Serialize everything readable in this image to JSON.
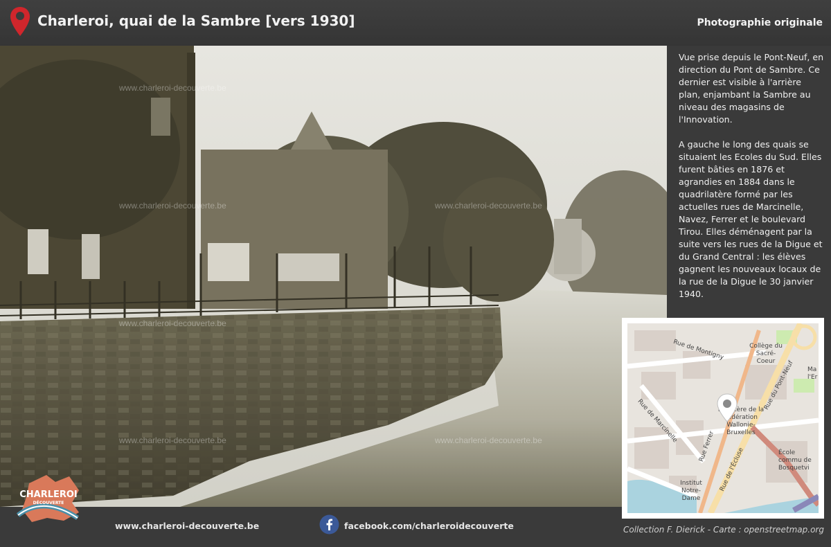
{
  "header": {
    "title": "Charleroi, quai de la Sambre [vers 1930]",
    "subtitle": "Photographie originale",
    "pin_icon": "map-pin-icon",
    "accent_color": "#d0262c"
  },
  "photo": {
    "watermark": "www.charleroi-decouverte.be"
  },
  "description": {
    "paragraph_1": "Vue prise depuis le Pont-Neuf, en direction du Pont de Sambre. Ce dernier est visible à l'arrière plan, enjambant la Sambre au niveau des magasins de l'Innovation.",
    "paragraph_2": "A gauche le long des quais se situaient les Ecoles du Sud. Elles furent bâties en 1876 et agrandies en 1884 dans le quadrilatère formé par les actuelles rues de Marcinelle, Navez, Ferrer et le boulevard Tirou. Elles déménagent par la suite vers les rues de la Digue et du Grand Central : les élèves gagnent les nouveaux locaux de la rue de la Digue le 30 janvier 1940."
  },
  "map": {
    "streets": {
      "montigny": "Rue de Montigny",
      "pont_neuf": "Rue du Pont-Neuf",
      "marcinelle": "Rue de Marcinelle",
      "ferrer": "Rue Ferrer",
      "ecluse": "Rue de l'Écluse"
    },
    "pois": {
      "college": "Collège du Sacré-Coeur",
      "ministere": "Ministère de la Fédération Wallonie-Bruxelles",
      "ecole": "École commu de Bosquetvi",
      "institut": "Institut Notre-Dame",
      "edge": "Ma l'Er"
    }
  },
  "footer": {
    "logo_text": "CHARLEROI",
    "logo_subtext": "DÉCOUVERTE",
    "website": "www.charleroi-decouverte.be",
    "facebook": "facebook.com/charleroidecouverte",
    "facebook_icon": "facebook-icon",
    "credit": "Collection F. Dierick - Carte : openstreetmap.org"
  }
}
